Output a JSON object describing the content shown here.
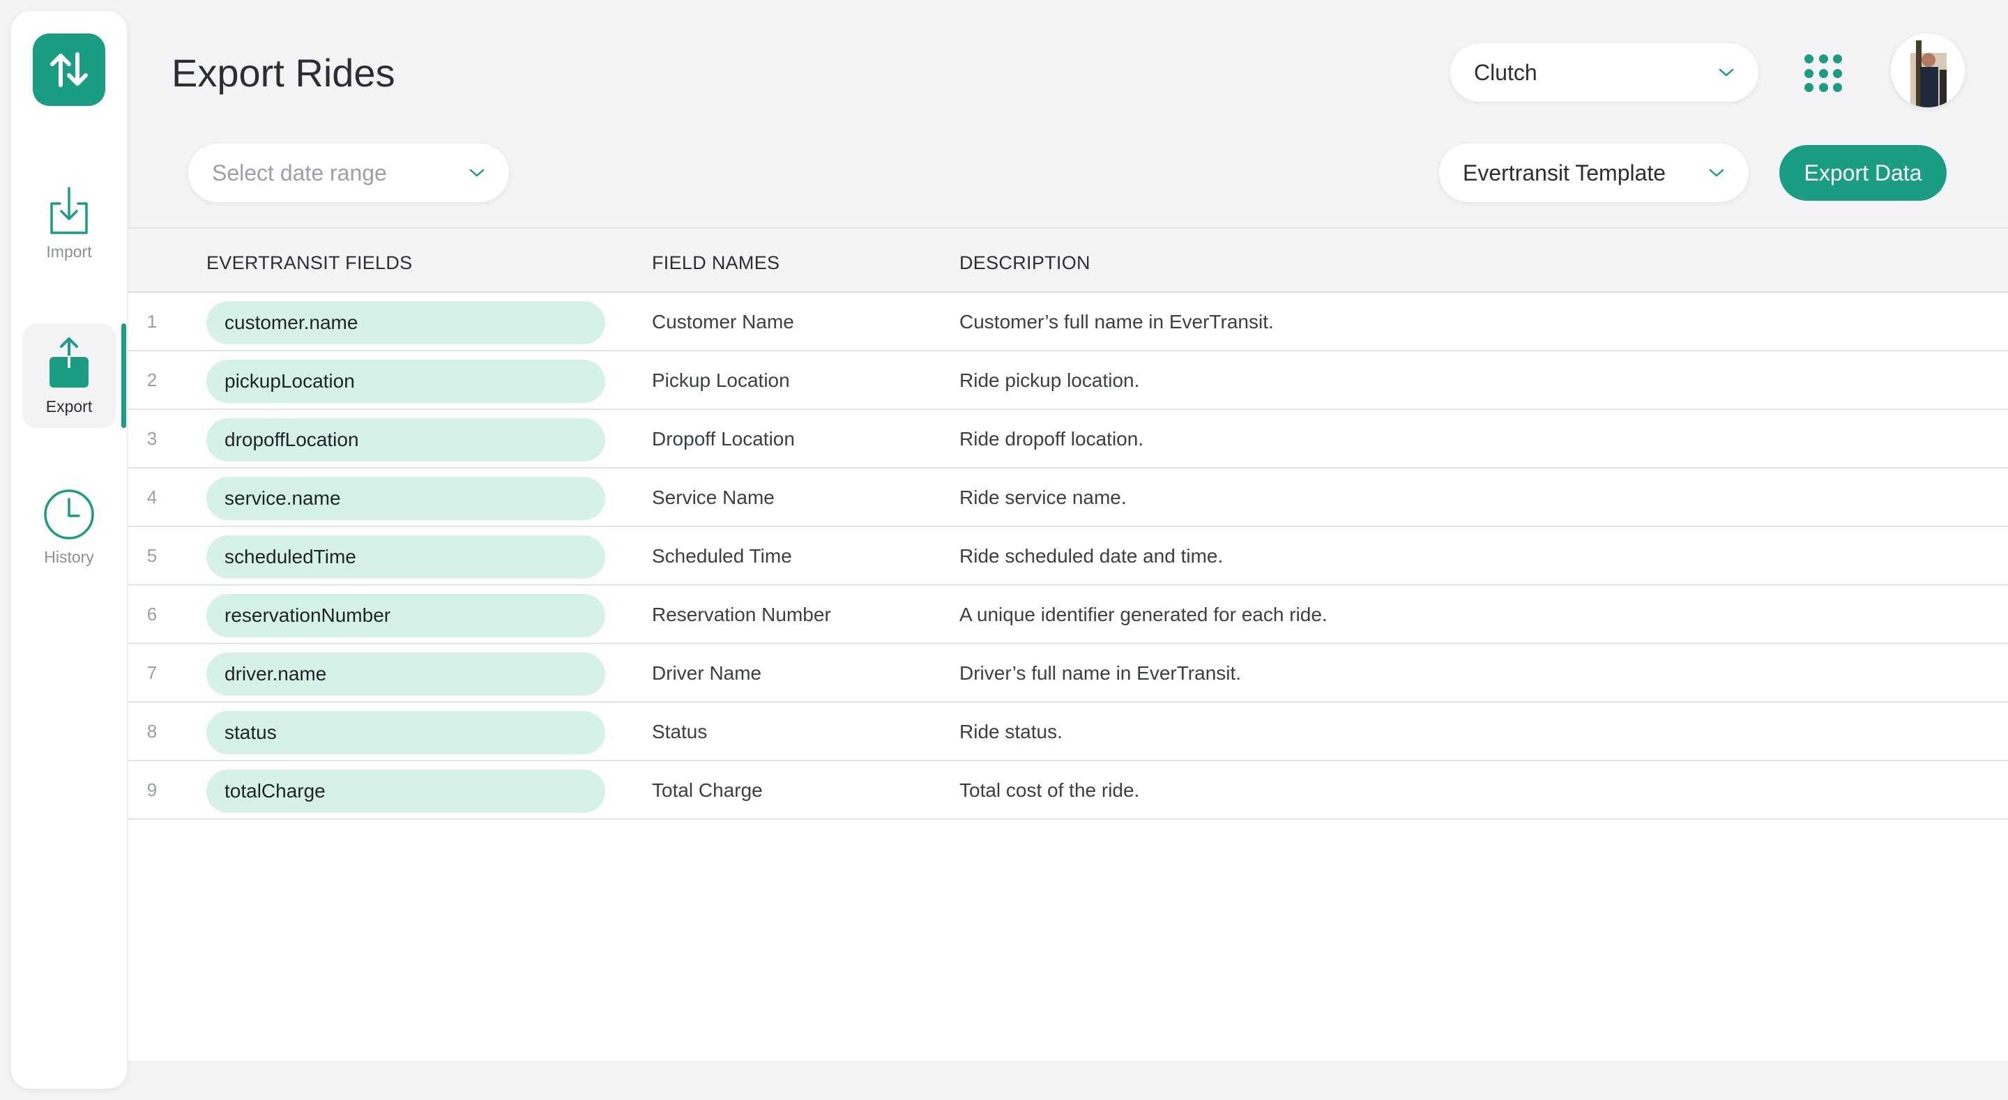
{
  "app": {
    "page_title": "Export Rides",
    "accent_color": "#1a9d82",
    "chip_color": "#d5f1ea"
  },
  "sidebar": {
    "logo_icon": "up-down-arrows-icon",
    "items": [
      {
        "label": "Import",
        "icon": "import-icon",
        "active": false
      },
      {
        "label": "Export",
        "icon": "export-icon",
        "active": true
      },
      {
        "label": "History",
        "icon": "clock-icon",
        "active": false
      }
    ]
  },
  "header": {
    "org_select_value": "Clutch",
    "apps_icon": "grid-icon",
    "avatar_icon": "avatar"
  },
  "toolbar": {
    "date_range_placeholder": "Select date range",
    "template_select_value": "Evertransit Template",
    "export_button_label": "Export Data"
  },
  "table": {
    "columns": [
      "EVERTRANSIT FIELDS",
      "FIELD NAMES",
      "DESCRIPTION"
    ],
    "rows": [
      {
        "num": "1",
        "field": "customer.name",
        "name": "Customer Name",
        "description": "Customer’s full name in EverTransit."
      },
      {
        "num": "2",
        "field": "pickupLocation",
        "name": "Pickup Location",
        "description": "Ride pickup location."
      },
      {
        "num": "3",
        "field": "dropoffLocation",
        "name": "Dropoff Location",
        "description": "Ride dropoff location."
      },
      {
        "num": "4",
        "field": "service.name",
        "name": "Service Name",
        "description": "Ride service name."
      },
      {
        "num": "5",
        "field": "scheduledTime",
        "name": "Scheduled Time",
        "description": "Ride scheduled date and time."
      },
      {
        "num": "6",
        "field": "reservationNumber",
        "name": "Reservation Number",
        "description": "A unique identifier generated for each ride."
      },
      {
        "num": "7",
        "field": "driver.name",
        "name": "Driver Name",
        "description": "Driver’s full name in EverTransit."
      },
      {
        "num": "8",
        "field": "status",
        "name": "Status",
        "description": "Ride status."
      },
      {
        "num": "9",
        "field": "totalCharge",
        "name": "Total Charge",
        "description": "Total cost of the ride."
      }
    ]
  }
}
